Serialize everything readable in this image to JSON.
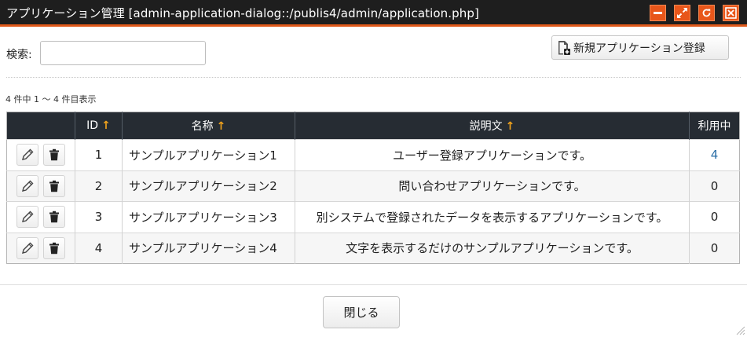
{
  "window": {
    "title": "アプリケーション管理 [admin-application-dialog::/publis4/admin/application.php]",
    "colors": {
      "titlebar_bg": "#1e1e1e",
      "accent": "#e8561a",
      "table_header_bg": "#262c33",
      "sort_arrow": "#f0a21c",
      "link": "#2a6ea6"
    },
    "buttons": {
      "minimize_icon": "minimize-icon",
      "maximize_icon": "maximize-icon",
      "refresh_icon": "refresh-icon",
      "close_icon": "close-x-icon"
    }
  },
  "search": {
    "label": "検索:",
    "value": "",
    "placeholder": ""
  },
  "new_button": {
    "label": "新規アプリケーション登録",
    "icon": "new-document-icon"
  },
  "count_text": "4 件中 1 ～ 4 件目表示",
  "table": {
    "headers": {
      "actions": "",
      "id": "ID",
      "name": "名称",
      "description": "説明文",
      "usage": "利用中"
    },
    "sort_arrow": "↑",
    "rows": [
      {
        "id": "1",
        "name": "サンプルアプリケーション1",
        "description": "ユーザー登録アプリケーションです。",
        "usage": "4"
      },
      {
        "id": "2",
        "name": "サンプルアプリケーション2",
        "description": "問い合わせアプリケーションです。",
        "usage": "0"
      },
      {
        "id": "3",
        "name": "サンプルアプリケーション3",
        "description": "別システムで登録されたデータを表示するアプリケーションです。",
        "usage": "0"
      },
      {
        "id": "4",
        "name": "サンプルアプリケーション4",
        "description": "文字を表示するだけのサンプルアプリケーションです。",
        "usage": "0"
      }
    ]
  },
  "close_button": {
    "label": "閉じる"
  }
}
